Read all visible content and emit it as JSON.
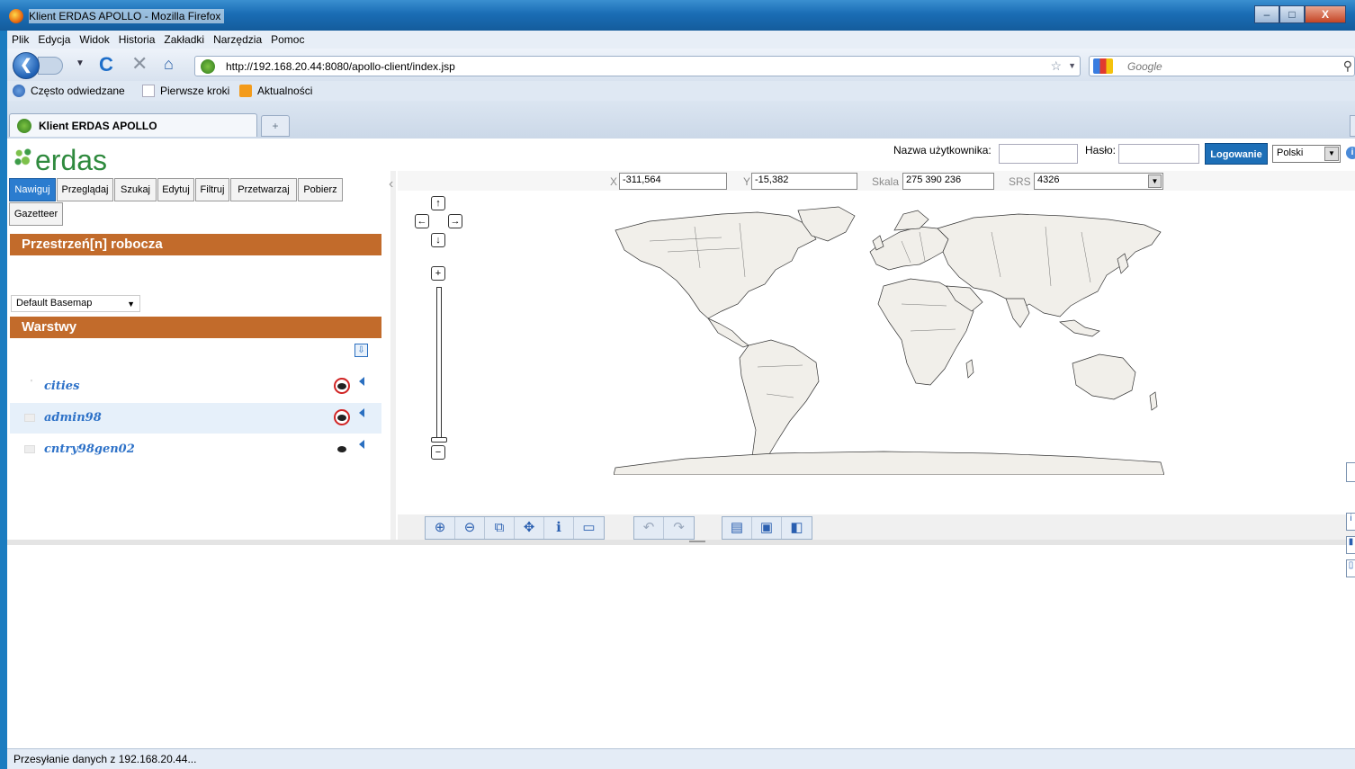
{
  "window": {
    "title": "Klient ERDAS APOLLO - Mozilla Firefox",
    "min": "–",
    "max": "□",
    "close": "X"
  },
  "menu": [
    "Plik",
    "Edycja",
    "Widok",
    "Historia",
    "Zakładki",
    "Narzędzia",
    "Pomoc"
  ],
  "nav": {
    "url": "http://192.168.20.44:8080/apollo-client/index.jsp",
    "search_placeholder": "Google"
  },
  "bookmarks": [
    "Często odwiedzane",
    "Pierwsze kroki",
    "Aktualności"
  ],
  "tab": {
    "title": "Klient ERDAS APOLLO",
    "new_tab": "+"
  },
  "app": {
    "logo_text": "erdas",
    "user_label": "Nazwa użytkownika:",
    "password_label": "Hasło:",
    "login_button": "Logowanie",
    "language": "Polski",
    "help": "i"
  },
  "nav_tabs": [
    "Nawiguj",
    "Przeglądaj",
    "Szukaj",
    "Edytuj",
    "Filtruj",
    "Przetwarzaj",
    "Pobierz",
    "Gazetteer"
  ],
  "workspace": {
    "header": "Przestrzeń[n] robocza",
    "basemap": "Default Basemap"
  },
  "layers": {
    "header": "Warstwy",
    "items": [
      {
        "name": "cities",
        "visible": false,
        "selected": false
      },
      {
        "name": "admin98",
        "visible": false,
        "selected": true
      },
      {
        "name": "cntry98gen02",
        "visible": true,
        "selected": false
      }
    ]
  },
  "coords": {
    "x_label": "X",
    "x_value": "-311,564",
    "y_label": "Y",
    "y_value": "-15,382",
    "scale_label": "Skala",
    "scale_value": "275 390 236",
    "srs_label": "SRS",
    "srs_value": "4326"
  },
  "pan": {
    "up": "↑",
    "down": "↓",
    "left": "←",
    "right": "→",
    "zoom_in": "+",
    "zoom_out": "−"
  },
  "status": "Przesyłanie danych z 192.168.20.44...",
  "colors": {
    "accent": "#c26b2b",
    "active_tab": "#2b7ccf",
    "layer_text": "#2e72c8",
    "land": "#f1efea"
  }
}
